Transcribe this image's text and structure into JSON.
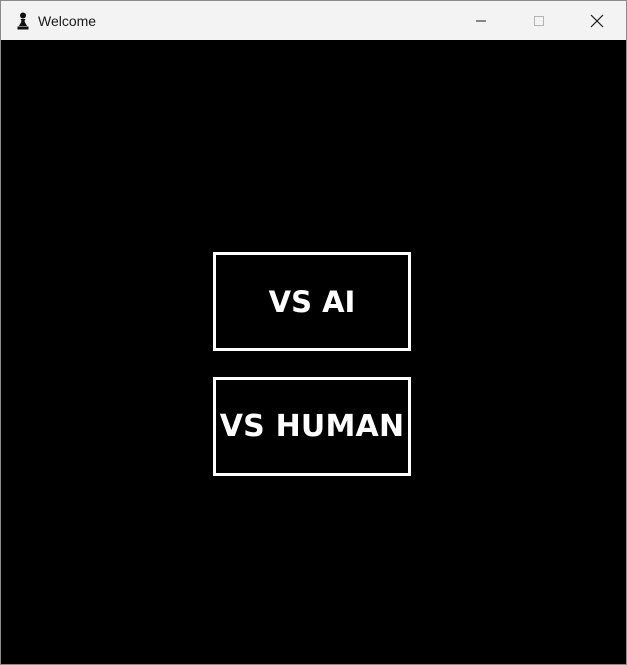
{
  "window": {
    "title": "Welcome",
    "app_icon": "pawn-icon",
    "controls": {
      "minimize_icon": "minimize-icon",
      "maximize_icon": "maximize-icon",
      "close_icon": "close-icon"
    }
  },
  "menu": {
    "vs_ai_label": "VS AI",
    "vs_human_label": "VS HUMAN"
  },
  "colors": {
    "background": "#000000",
    "button_border": "#ffffff",
    "button_text": "#ffffff",
    "titlebar": "#f3f3f3"
  }
}
